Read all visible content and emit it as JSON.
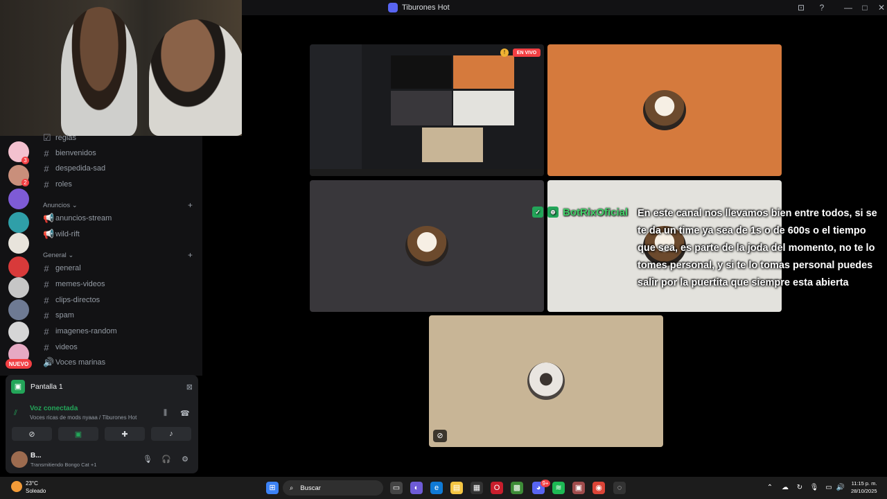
{
  "window": {
    "title": "Tiburones Hot",
    "buttons": {
      "inbox_icon": "⊡",
      "help_icon": "?",
      "minimize": "—",
      "maximize": "□",
      "close": "✕"
    }
  },
  "channels": {
    "items": [
      {
        "name": "reglas",
        "icon": "rules-icon"
      },
      {
        "name": "bienvenidos",
        "icon": "hash-icon"
      },
      {
        "name": "despedida-sad",
        "icon": "hash-icon"
      },
      {
        "name": "roles",
        "icon": "hash-icon"
      }
    ],
    "cat1": "Anuncios ⌄",
    "cat1_items": [
      {
        "name": "anuncios-stream",
        "icon": "megaphone-icon"
      },
      {
        "name": "wild-rift",
        "icon": "megaphone-icon"
      }
    ],
    "cat2": "General ⌄",
    "cat2_items": [
      {
        "name": "general",
        "icon": "hash-icon"
      },
      {
        "name": "memes-videos",
        "icon": "hash-icon"
      },
      {
        "name": "clips-directos",
        "icon": "hash-icon"
      },
      {
        "name": "spam",
        "icon": "hash-icon"
      },
      {
        "name": "imagenes-random",
        "icon": "hash-icon"
      },
      {
        "name": "videos",
        "icon": "hash-icon"
      },
      {
        "name": "Voces marinas",
        "icon": "speaker-icon"
      }
    ]
  },
  "rail": {
    "nuevo": "NUEVO",
    "badge_1": "3",
    "badge_2": "2"
  },
  "screen_share": {
    "label": "Pantalla 1"
  },
  "voice": {
    "title": "Voz conectada",
    "subtitle": "Voces ricas de mods nyaaa / Tiburones Hot"
  },
  "user": {
    "name": "B...",
    "status": "Transmitiendo Bongo Cat +1"
  },
  "stage": {
    "live_label": "EN VIVO",
    "bot_name": "BotRixOficial",
    "bot_message": "En este canal nos llevamos bien entre todos, si se te da un time ya sea de 1s o de 600s o el tiempo que sea, es parte de la joda del momento, no te lo tomes personal, y si te lo tomas personal puedes salir por la puertita que siempre esta abierta"
  },
  "taskbar": {
    "weather_temp": "23°C",
    "weather_desc": "Soleado",
    "search_placeholder": "Buscar",
    "time": "11:15 p. m.",
    "date": "28/10/2025",
    "discord_badge": "9+"
  },
  "colors": {
    "accent_green": "#23a559",
    "danger_red": "#f23f43",
    "tile_orange": "#d57a3d",
    "tile_beige": "#c8b596"
  }
}
